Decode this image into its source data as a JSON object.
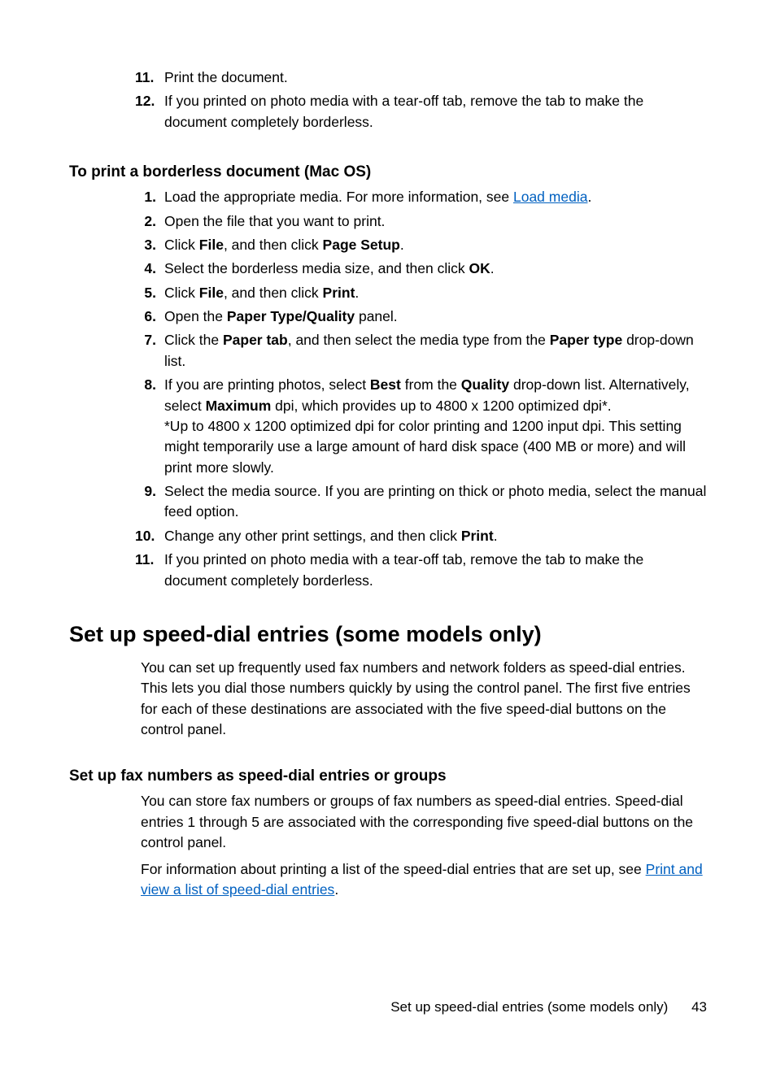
{
  "top_steps": {
    "s11": {
      "num": "11.",
      "text": "Print the document."
    },
    "s12": {
      "num": "12.",
      "text": "If you printed on photo media with a tear-off tab, remove the tab to make the document completely borderless."
    }
  },
  "mac_heading": "To print a borderless document (Mac OS)",
  "mac_steps": {
    "s1": {
      "num": "1.",
      "pre": "Load the appropriate media. For more information, see ",
      "link": "Load media",
      "post": "."
    },
    "s2": {
      "num": "2.",
      "text": "Open the file that you want to print."
    },
    "s3": {
      "num": "3.",
      "t1": "Click ",
      "b1": "File",
      "t2": ", and then click ",
      "b2": "Page Setup",
      "t3": "."
    },
    "s4": {
      "num": "4.",
      "t1": "Select the borderless media size, and then click ",
      "b1": "OK",
      "t2": "."
    },
    "s5": {
      "num": "5.",
      "t1": "Click ",
      "b1": "File",
      "t2": ", and then click ",
      "b2": "Print",
      "t3": "."
    },
    "s6": {
      "num": "6.",
      "t1": "Open the ",
      "b1": "Paper Type/Quality",
      "t2": " panel."
    },
    "s7": {
      "num": "7.",
      "t1": "Click the ",
      "b1": "Paper tab",
      "t2": ", and then select the media type from the ",
      "b2": "Paper type",
      "t3": " drop-down list."
    },
    "s8": {
      "num": "8.",
      "p1a": "If you are printing photos, select ",
      "p1b1": "Best",
      "p1c": " from the ",
      "p1b2": "Quality",
      "p1d": " drop-down list. Alternatively, select ",
      "p1b3": "Maximum",
      "p1e": " dpi, which provides up to 4800 x 1200 optimized dpi*.",
      "p2": "*Up to 4800 x 1200 optimized dpi for color printing and 1200 input dpi. This setting might temporarily use a large amount of hard disk space (400 MB or more) and will print more slowly."
    },
    "s9": {
      "num": "9.",
      "text": "Select the media source. If you are printing on thick or photo media, select the manual feed option."
    },
    "s10": {
      "num": "10.",
      "t1": "Change any other print settings, and then click ",
      "b1": "Print",
      "t2": "."
    },
    "s11": {
      "num": "11.",
      "text": "If you printed on photo media with a tear-off tab, remove the tab to make the document completely borderless."
    }
  },
  "speed_dial_heading": "Set up speed-dial entries (some models only)",
  "speed_dial_intro": "You can set up frequently used fax numbers and network folders as speed-dial entries. This lets you dial those numbers quickly by using the control panel. The first five entries for each of these destinations are associated with the five speed-dial buttons on the control panel.",
  "fax_heading": "Set up fax numbers as speed-dial entries or groups",
  "fax_p1": "You can store fax numbers or groups of fax numbers as speed-dial entries. Speed-dial entries 1 through 5 are associated with the corresponding five speed-dial buttons on the control panel.",
  "fax_p2": {
    "pre": "For information about printing a list of the speed-dial entries that are set up, see ",
    "link": "Print and view a list of speed-dial entries",
    "post": "."
  },
  "footer": {
    "title": "Set up speed-dial entries (some models only)",
    "page": "43"
  }
}
